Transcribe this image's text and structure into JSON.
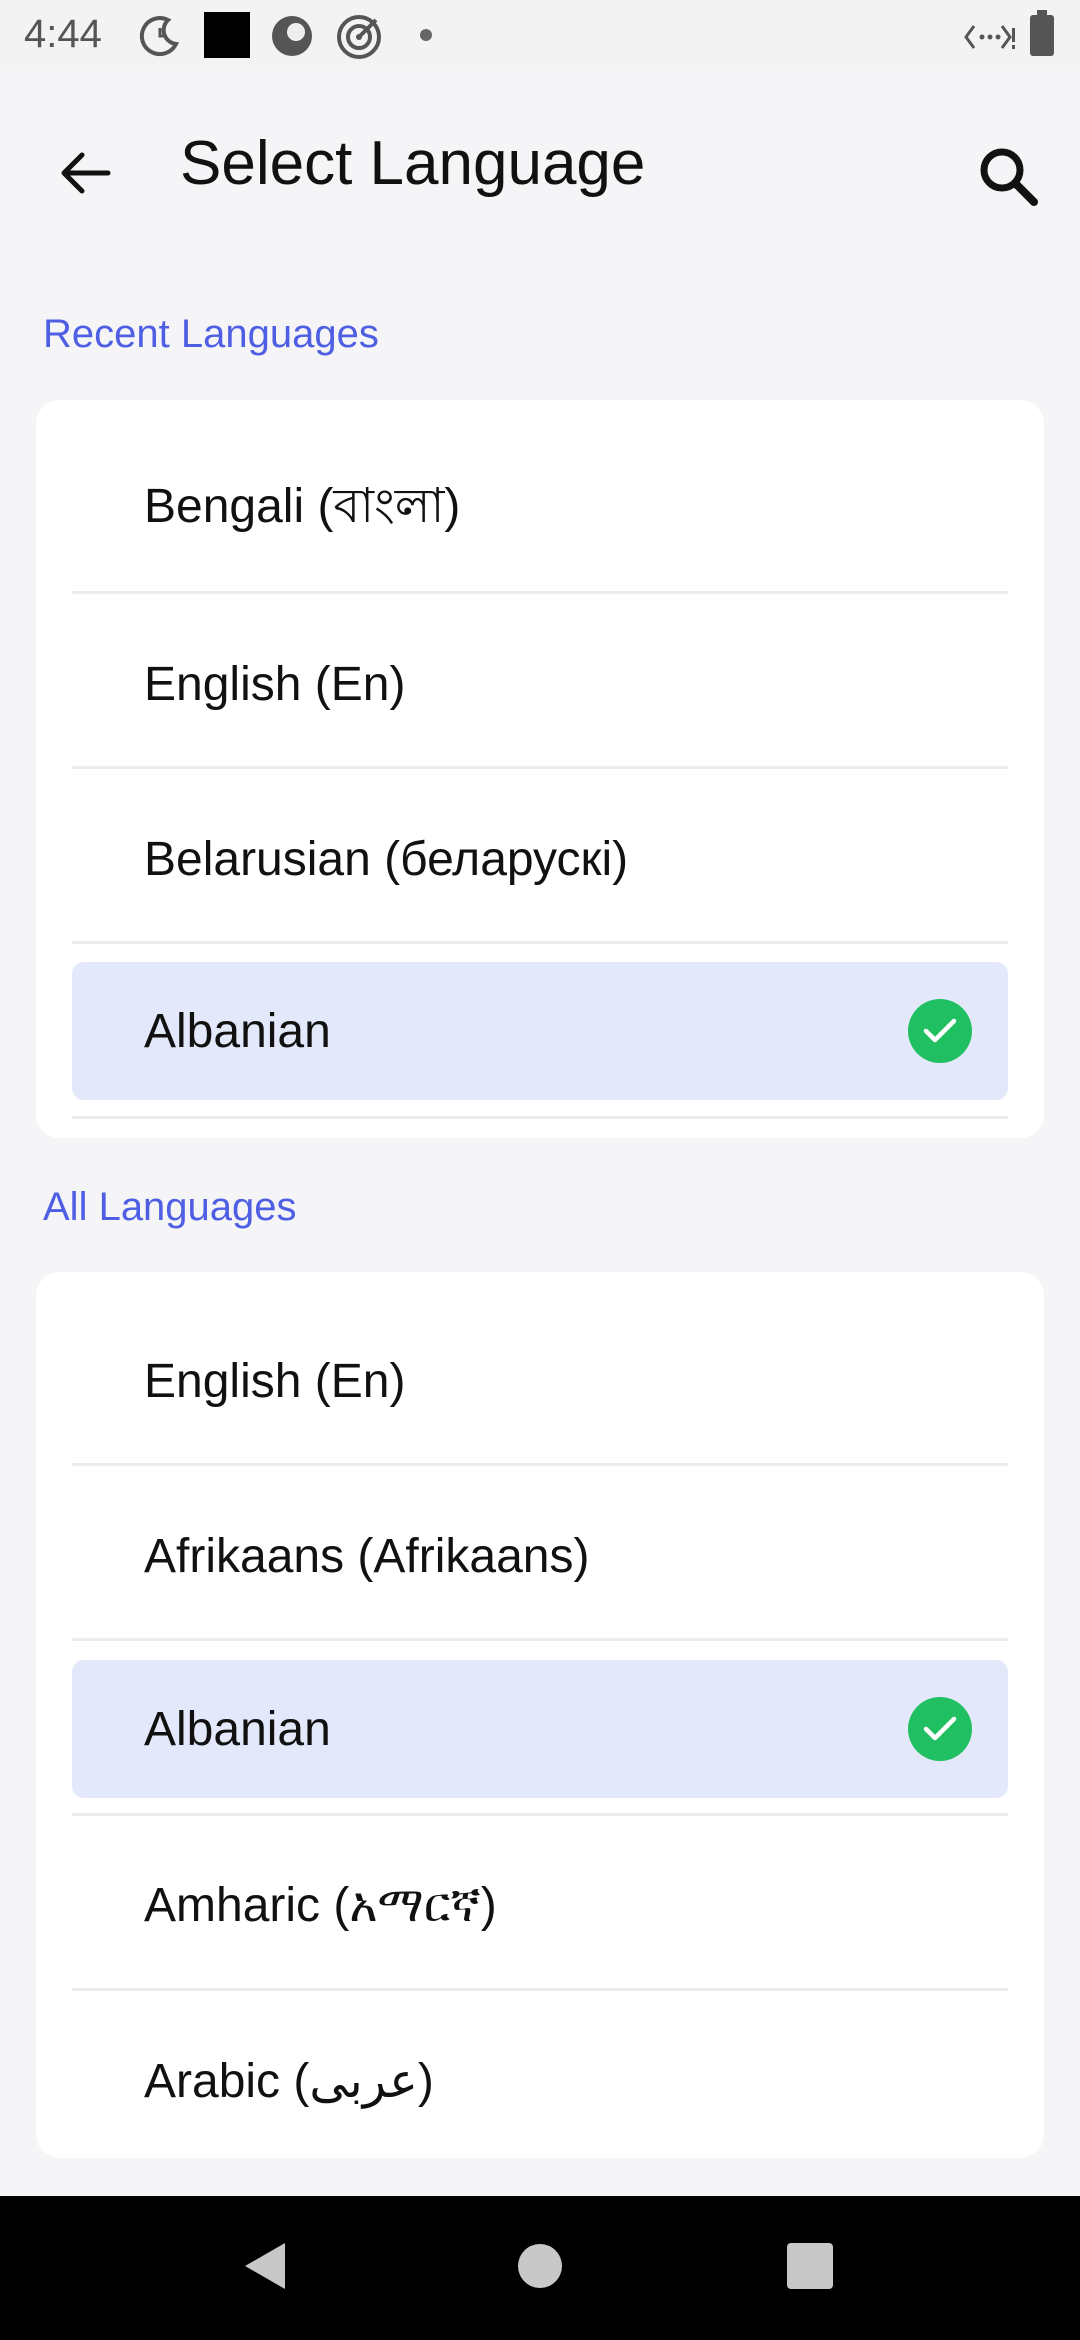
{
  "status_bar": {
    "time": "4:44",
    "icons": [
      "moon-clock-icon",
      "black-square-icon",
      "record-icon",
      "target-icon",
      "dot-icon",
      "network-icon",
      "battery-icon"
    ]
  },
  "app_bar": {
    "title": "Select Language",
    "back_icon": "arrow-left-icon",
    "search_icon": "search-icon"
  },
  "recent": {
    "title": "Recent Languages",
    "items": [
      {
        "label": "Bengali (বাংলা)",
        "selected": false
      },
      {
        "label": "English (En)",
        "selected": false
      },
      {
        "label": "Belarusian (беларускі)",
        "selected": false
      },
      {
        "label": "Albanian",
        "selected": true
      }
    ]
  },
  "all": {
    "title": "All Languages",
    "items": [
      {
        "label": "English (En)",
        "selected": false
      },
      {
        "label": "Afrikaans (Afrikaans)",
        "selected": false
      },
      {
        "label": "Albanian",
        "selected": true
      },
      {
        "label": "Amharic (አማርኛ)",
        "selected": false
      },
      {
        "label": "Arabic (عربى)",
        "selected": false
      }
    ]
  },
  "colors": {
    "accent": "#4f5fe3",
    "selected_bg": "#e3e8fb",
    "check": "#20c062"
  },
  "nav_bar": {
    "back": "nav-back-icon",
    "home": "nav-home-icon",
    "recents": "nav-recents-icon"
  }
}
